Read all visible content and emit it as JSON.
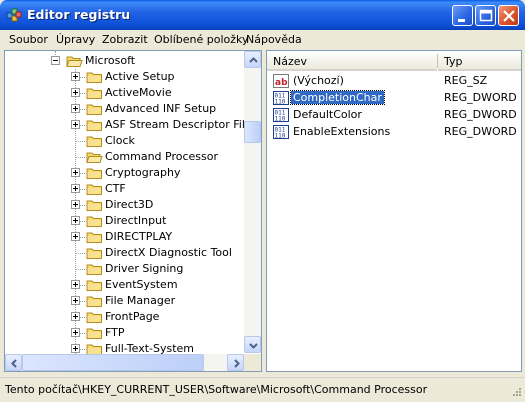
{
  "window": {
    "title": "Editor registru",
    "buttons": [
      "minimize-icon",
      "maximize-icon",
      "close-icon"
    ],
    "colors": {
      "titlebar": "#0b4fd6",
      "selection": "#316ac5",
      "folder": "#f5d76e"
    }
  },
  "menu": [
    "Soubor",
    "Úpravy",
    "Zobrazit",
    "Oblíbené položky",
    "Nápověda"
  ],
  "tree": {
    "root": {
      "label": "Microsoft",
      "expanded": true
    },
    "items": [
      {
        "label": "Active Setup",
        "expander": "plus"
      },
      {
        "label": "ActiveMovie",
        "expander": "plus"
      },
      {
        "label": "Advanced INF Setup",
        "expander": "plus"
      },
      {
        "label": "ASF Stream Descriptor File",
        "expander": "plus"
      },
      {
        "label": "Clock",
        "expander": "none"
      },
      {
        "label": "Command Processor",
        "expander": "none",
        "selected": true
      },
      {
        "label": "Cryptography",
        "expander": "plus"
      },
      {
        "label": "CTF",
        "expander": "plus"
      },
      {
        "label": "Direct3D",
        "expander": "plus"
      },
      {
        "label": "DirectInput",
        "expander": "plus"
      },
      {
        "label": "DIRECTPLAY",
        "expander": "plus"
      },
      {
        "label": "DirectX Diagnostic Tool",
        "expander": "none"
      },
      {
        "label": "Driver Signing",
        "expander": "none"
      },
      {
        "label": "EventSystem",
        "expander": "plus"
      },
      {
        "label": "File Manager",
        "expander": "plus"
      },
      {
        "label": "FrontPage",
        "expander": "plus"
      },
      {
        "label": "FTP",
        "expander": "plus"
      },
      {
        "label": "Full-Text-System",
        "expander": "plus"
      }
    ]
  },
  "list": {
    "columns": {
      "name": "Název",
      "type": "Typ"
    },
    "rows": [
      {
        "name": "(Výchozí)",
        "type": "REG_SZ",
        "icon": "reg-sz-icon",
        "selected": false
      },
      {
        "name": "CompletionChar",
        "type": "REG_DWORD",
        "icon": "reg-dword-icon",
        "selected": true
      },
      {
        "name": "DefaultColor",
        "type": "REG_DWORD",
        "icon": "reg-dword-icon",
        "selected": false
      },
      {
        "name": "EnableExtensions",
        "type": "REG_DWORD",
        "icon": "reg-dword-icon",
        "selected": false
      }
    ]
  },
  "status": {
    "path": "Tento počítač\\HKEY_CURRENT_USER\\Software\\Microsoft\\Command Processor"
  }
}
